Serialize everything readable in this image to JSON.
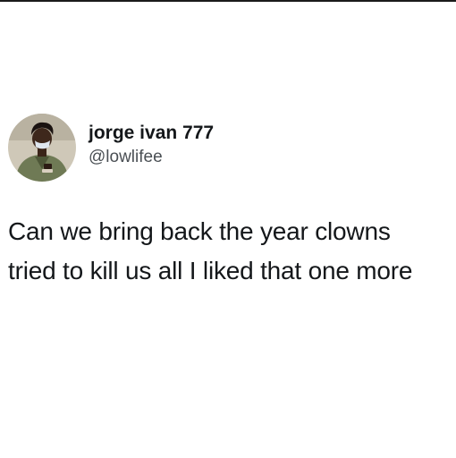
{
  "tweet": {
    "author": {
      "display_name": "jorge ivan 777",
      "handle": "@lowlifee",
      "avatar_icon": "profile-photo"
    },
    "text_lines": [
      "Can we bring back the year clowns",
      "tried to kill us all I liked that one more"
    ]
  }
}
